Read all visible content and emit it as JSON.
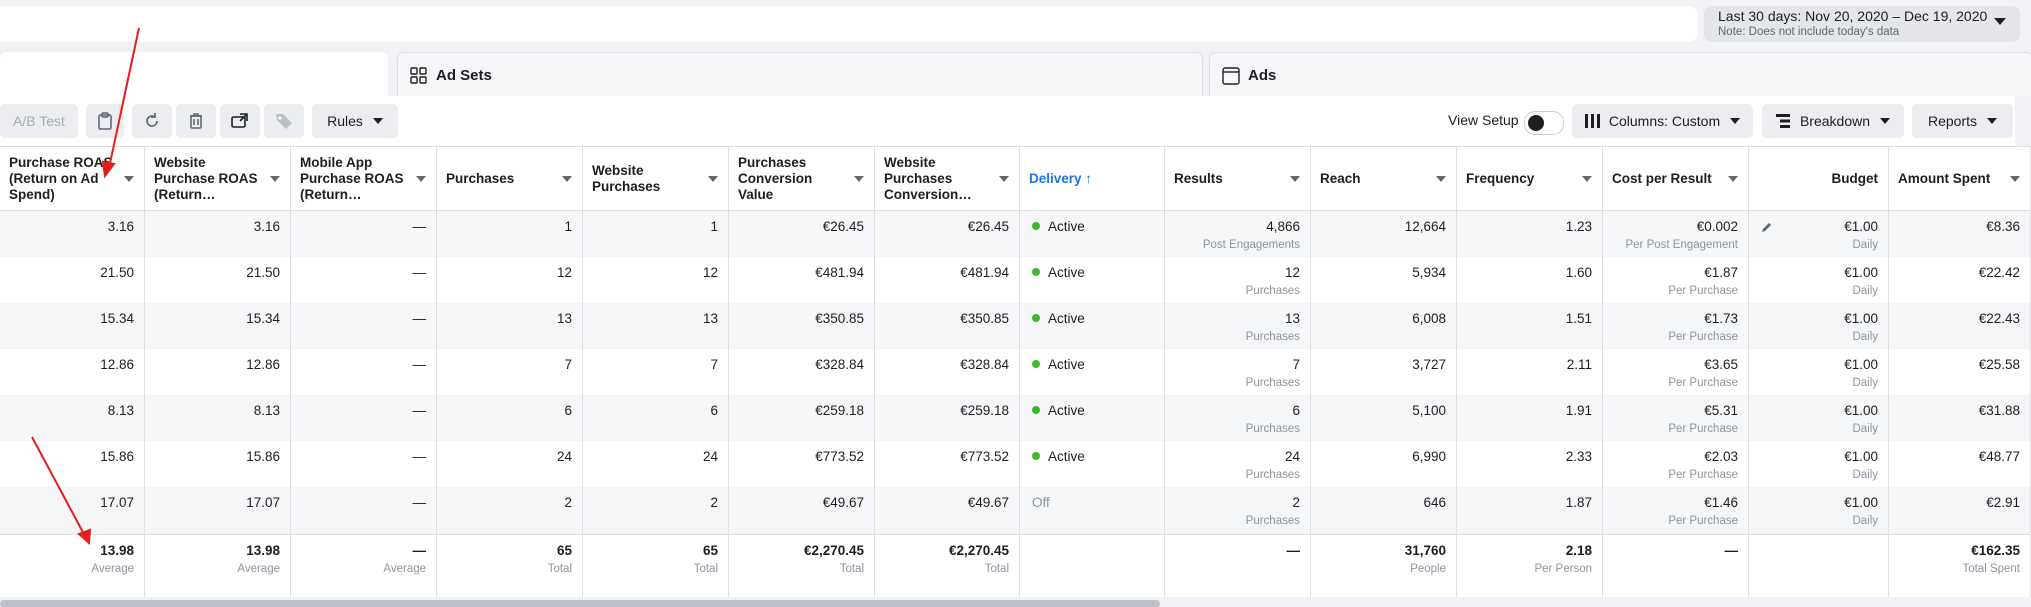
{
  "date_range": {
    "label": "Last 30 days: Nov 20, 2020 – Dec 19, 2020",
    "note": "Note: Does not include today's data"
  },
  "tabs": [
    {
      "label": "Ad Sets",
      "icon": "ad-sets-icon"
    },
    {
      "label": "Ads",
      "icon": "ads-icon"
    }
  ],
  "toolbar": {
    "ab_test": "A/B Test",
    "rules": "Rules",
    "view_setup": "View Setup",
    "columns": "Columns: Custom",
    "breakdown": "Breakdown",
    "reports": "Reports"
  },
  "columns": [
    "Purchase ROAS (Return on Ad Spend)",
    "Website Purchase ROAS (Return…",
    "Mobile App Purchase ROAS (Return…",
    "Purchases",
    "Website Purchases",
    "Purchases Conversion Value",
    "Website Purchases Conversion…",
    "Delivery ↑",
    "Results",
    "Reach",
    "Frequency",
    "Cost per Result",
    "Budget",
    "Amount Spent"
  ],
  "rows": [
    {
      "roas": "3.16",
      "web_roas": "3.16",
      "app_roas": "—",
      "purchases": "1",
      "web_purchases": "1",
      "conv_value": "€26.45",
      "web_conv_value": "€26.45",
      "delivery": "Active",
      "results": "4,866",
      "results_type": "Post Engagements",
      "reach": "12,664",
      "frequency": "1.23",
      "cpr": "€0.002",
      "cpr_type": "Per Post Engagement",
      "budget": "€1.00",
      "budget_type": "Daily",
      "spent": "€8.36"
    },
    {
      "roas": "21.50",
      "web_roas": "21.50",
      "app_roas": "—",
      "purchases": "12",
      "web_purchases": "12",
      "conv_value": "€481.94",
      "web_conv_value": "€481.94",
      "delivery": "Active",
      "results": "12",
      "results_type": "Purchases",
      "reach": "5,934",
      "frequency": "1.60",
      "cpr": "€1.87",
      "cpr_type": "Per Purchase",
      "budget": "€1.00",
      "budget_type": "Daily",
      "spent": "€22.42"
    },
    {
      "roas": "15.34",
      "web_roas": "15.34",
      "app_roas": "—",
      "purchases": "13",
      "web_purchases": "13",
      "conv_value": "€350.85",
      "web_conv_value": "€350.85",
      "delivery": "Active",
      "results": "13",
      "results_type": "Purchases",
      "reach": "6,008",
      "frequency": "1.51",
      "cpr": "€1.73",
      "cpr_type": "Per Purchase",
      "budget": "€1.00",
      "budget_type": "Daily",
      "spent": "€22.43"
    },
    {
      "roas": "12.86",
      "web_roas": "12.86",
      "app_roas": "—",
      "purchases": "7",
      "web_purchases": "7",
      "conv_value": "€328.84",
      "web_conv_value": "€328.84",
      "delivery": "Active",
      "results": "7",
      "results_type": "Purchases",
      "reach": "3,727",
      "frequency": "2.11",
      "cpr": "€3.65",
      "cpr_type": "Per Purchase",
      "budget": "€1.00",
      "budget_type": "Daily",
      "spent": "€25.58"
    },
    {
      "roas": "8.13",
      "web_roas": "8.13",
      "app_roas": "—",
      "purchases": "6",
      "web_purchases": "6",
      "conv_value": "€259.18",
      "web_conv_value": "€259.18",
      "delivery": "Active",
      "results": "6",
      "results_type": "Purchases",
      "reach": "5,100",
      "frequency": "1.91",
      "cpr": "€5.31",
      "cpr_type": "Per Purchase",
      "budget": "€1.00",
      "budget_type": "Daily",
      "spent": "€31.88"
    },
    {
      "roas": "15.86",
      "web_roas": "15.86",
      "app_roas": "—",
      "purchases": "24",
      "web_purchases": "24",
      "conv_value": "€773.52",
      "web_conv_value": "€773.52",
      "delivery": "Active",
      "results": "24",
      "results_type": "Purchases",
      "reach": "6,990",
      "frequency": "2.33",
      "cpr": "€2.03",
      "cpr_type": "Per Purchase",
      "budget": "€1.00",
      "budget_type": "Daily",
      "spent": "€48.77"
    },
    {
      "roas": "17.07",
      "web_roas": "17.07",
      "app_roas": "—",
      "purchases": "2",
      "web_purchases": "2",
      "conv_value": "€49.67",
      "web_conv_value": "€49.67",
      "delivery": "Off",
      "results": "2",
      "results_type": "Purchases",
      "reach": "646",
      "frequency": "1.87",
      "cpr": "€1.46",
      "cpr_type": "Per Purchase",
      "budget": "€1.00",
      "budget_type": "Daily",
      "spent": "€2.91"
    }
  ],
  "totals": {
    "roas": "13.98",
    "roas_label": "Average",
    "web_roas": "13.98",
    "web_roas_label": "Average",
    "app_roas": "—",
    "app_roas_label": "Average",
    "purchases": "65",
    "purchases_label": "Total",
    "web_purchases": "65",
    "web_purchases_label": "Total",
    "conv_value": "€2,270.45",
    "conv_value_label": "Total",
    "web_conv_value": "€2,270.45",
    "web_conv_value_label": "Total",
    "results": "—",
    "reach": "31,760",
    "reach_label": "People",
    "frequency": "2.18",
    "frequency_label": "Per Person",
    "cpr": "—",
    "spent": "€162.35",
    "spent_label": "Total Spent"
  },
  "colors": {
    "active": "#42b72a",
    "delivery_header": "#1877f2",
    "annotation": "#e41e1e"
  }
}
